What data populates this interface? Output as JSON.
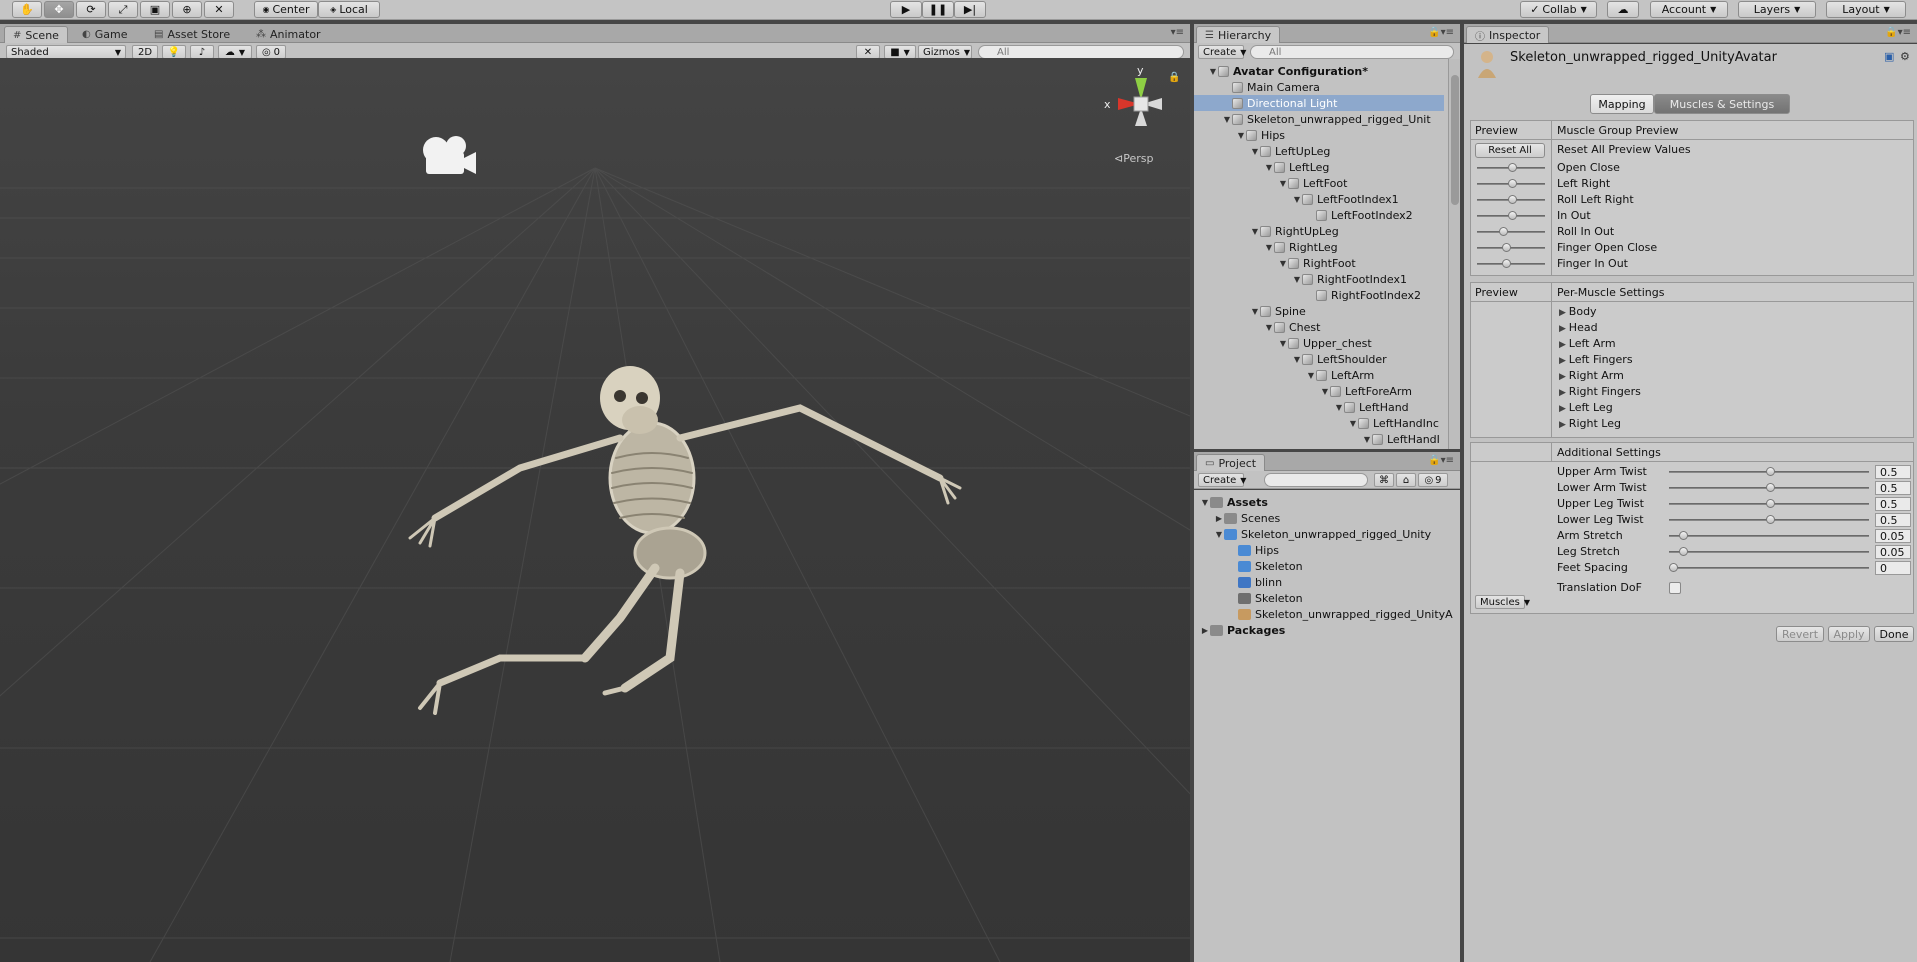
{
  "toolbar": {
    "tools": [
      "hand-tool-icon",
      "move-tool-icon",
      "rotate-tool-icon",
      "scale-tool-icon",
      "rect-tool-icon",
      "transform-tool-icon",
      "custom-tool-icon"
    ],
    "pivot_label": "Center",
    "space_label": "Local",
    "collab_label": "Collab",
    "account_label": "Account",
    "layers_label": "Layers",
    "layout_label": "Layout"
  },
  "scene_tabs": [
    {
      "label": "Scene"
    },
    {
      "label": "Game"
    },
    {
      "label": "Asset Store"
    },
    {
      "label": "Animator"
    }
  ],
  "scene_bar": {
    "shading": "Shaded",
    "mode_2d": "2D",
    "hidden_count": "0",
    "gizmos": "Gizmos",
    "search_placeholder": "All",
    "persp_label": "Persp",
    "axis_x": "x",
    "axis_y": "y"
  },
  "hierarchy": {
    "tab": "Hierarchy",
    "create": "Create",
    "search_placeholder": "All",
    "rows": [
      {
        "label": "Avatar Configuration*",
        "depth": 0,
        "tri": "▼",
        "bold": true
      },
      {
        "label": "Main Camera",
        "depth": 1,
        "tri": ""
      },
      {
        "label": "Directional Light",
        "depth": 1,
        "tri": "",
        "selected": true
      },
      {
        "label": "Skeleton_unwrapped_rigged_Unit",
        "depth": 1,
        "tri": "▼"
      },
      {
        "label": "Hips",
        "depth": 2,
        "tri": "▼"
      },
      {
        "label": "LeftUpLeg",
        "depth": 3,
        "tri": "▼"
      },
      {
        "label": "LeftLeg",
        "depth": 4,
        "tri": "▼"
      },
      {
        "label": "LeftFoot",
        "depth": 5,
        "tri": "▼"
      },
      {
        "label": "LeftFootIndex1",
        "depth": 6,
        "tri": "▼"
      },
      {
        "label": "LeftFootIndex2",
        "depth": 7,
        "tri": ""
      },
      {
        "label": "RightUpLeg",
        "depth": 3,
        "tri": "▼"
      },
      {
        "label": "RightLeg",
        "depth": 4,
        "tri": "▼"
      },
      {
        "label": "RightFoot",
        "depth": 5,
        "tri": "▼"
      },
      {
        "label": "RightFootIndex1",
        "depth": 6,
        "tri": "▼"
      },
      {
        "label": "RightFootIndex2",
        "depth": 7,
        "tri": ""
      },
      {
        "label": "Spine",
        "depth": 3,
        "tri": "▼"
      },
      {
        "label": "Chest",
        "depth": 4,
        "tri": "▼"
      },
      {
        "label": "Upper_chest",
        "depth": 5,
        "tri": "▼"
      },
      {
        "label": "LeftShoulder",
        "depth": 6,
        "tri": "▼"
      },
      {
        "label": "LeftArm",
        "depth": 7,
        "tri": "▼"
      },
      {
        "label": "LeftForeArm",
        "depth": 8,
        "tri": "▼"
      },
      {
        "label": "LeftHand",
        "depth": 9,
        "tri": "▼"
      },
      {
        "label": "LeftHandInc",
        "depth": 10,
        "tri": "▼"
      },
      {
        "label": "LeftHandI",
        "depth": 11,
        "tri": "▼"
      }
    ]
  },
  "project": {
    "tab": "Project",
    "create": "Create",
    "hidden_count": "9",
    "rows": [
      {
        "label": "Assets",
        "depth": 0,
        "tri": "▼",
        "icon": "folder",
        "bold": true
      },
      {
        "label": "Scenes",
        "depth": 1,
        "tri": "▶",
        "icon": "folder"
      },
      {
        "label": "Skeleton_unwrapped_rigged_Unity",
        "depth": 1,
        "tri": "▼",
        "icon": "model"
      },
      {
        "label": "Hips",
        "depth": 2,
        "tri": "",
        "icon": "model"
      },
      {
        "label": "Skeleton",
        "depth": 2,
        "tri": "",
        "icon": "model"
      },
      {
        "label": "blinn",
        "depth": 2,
        "tri": "",
        "icon": "material"
      },
      {
        "label": "Skeleton",
        "depth": 2,
        "tri": "",
        "icon": "mesh"
      },
      {
        "label": "Skeleton_unwrapped_rigged_UnityA",
        "depth": 2,
        "tri": "",
        "icon": "avatar"
      },
      {
        "label": "Packages",
        "depth": 0,
        "tri": "▶",
        "icon": "folder",
        "bold": true
      }
    ]
  },
  "inspector": {
    "tab": "Inspector",
    "object_name": "Skeleton_unwrapped_rigged_UnityAvatar",
    "mapping_tab": "Mapping",
    "muscles_tab": "Muscles & Settings",
    "preview_label": "Preview",
    "muscle_group_preview": "Muscle Group Preview",
    "reset_all_button": "Reset All",
    "reset_all_label": "Reset All Preview Values",
    "group_sliders": [
      {
        "label": "Open Close",
        "value": 0.5
      },
      {
        "label": "Left Right",
        "value": 0.5
      },
      {
        "label": "Roll Left Right",
        "value": 0.5
      },
      {
        "label": "In Out",
        "value": 0.5
      },
      {
        "label": "Roll In Out",
        "value": 0.35
      },
      {
        "label": "Finger Open Close",
        "value": 0.4
      },
      {
        "label": "Finger In Out",
        "value": 0.4
      }
    ],
    "preview_label2": "Preview",
    "per_muscle_settings": "Per-Muscle Settings",
    "muscle_groups": [
      "Body",
      "Head",
      "Left Arm",
      "Left Fingers",
      "Right Arm",
      "Right Fingers",
      "Left Leg",
      "Right Leg"
    ],
    "additional_settings": "Additional Settings",
    "settings": [
      {
        "label": "Upper Arm Twist",
        "value": "0.5",
        "fraction": 0.5
      },
      {
        "label": "Lower Arm Twist",
        "value": "0.5",
        "fraction": 0.5
      },
      {
        "label": "Upper Leg Twist",
        "value": "0.5",
        "fraction": 0.5
      },
      {
        "label": "Lower Leg Twist",
        "value": "0.5",
        "fraction": 0.5
      },
      {
        "label": "Arm Stretch",
        "value": "0.05",
        "fraction": 0.05
      },
      {
        "label": "Leg Stretch",
        "value": "0.05",
        "fraction": 0.05
      },
      {
        "label": "Feet Spacing",
        "value": "0",
        "fraction": 0.0
      }
    ],
    "translation_dof": "Translation DoF",
    "muscles_dropdown": "Muscles",
    "revert_button": "Revert",
    "apply_button": "Apply",
    "done_button": "Done"
  }
}
